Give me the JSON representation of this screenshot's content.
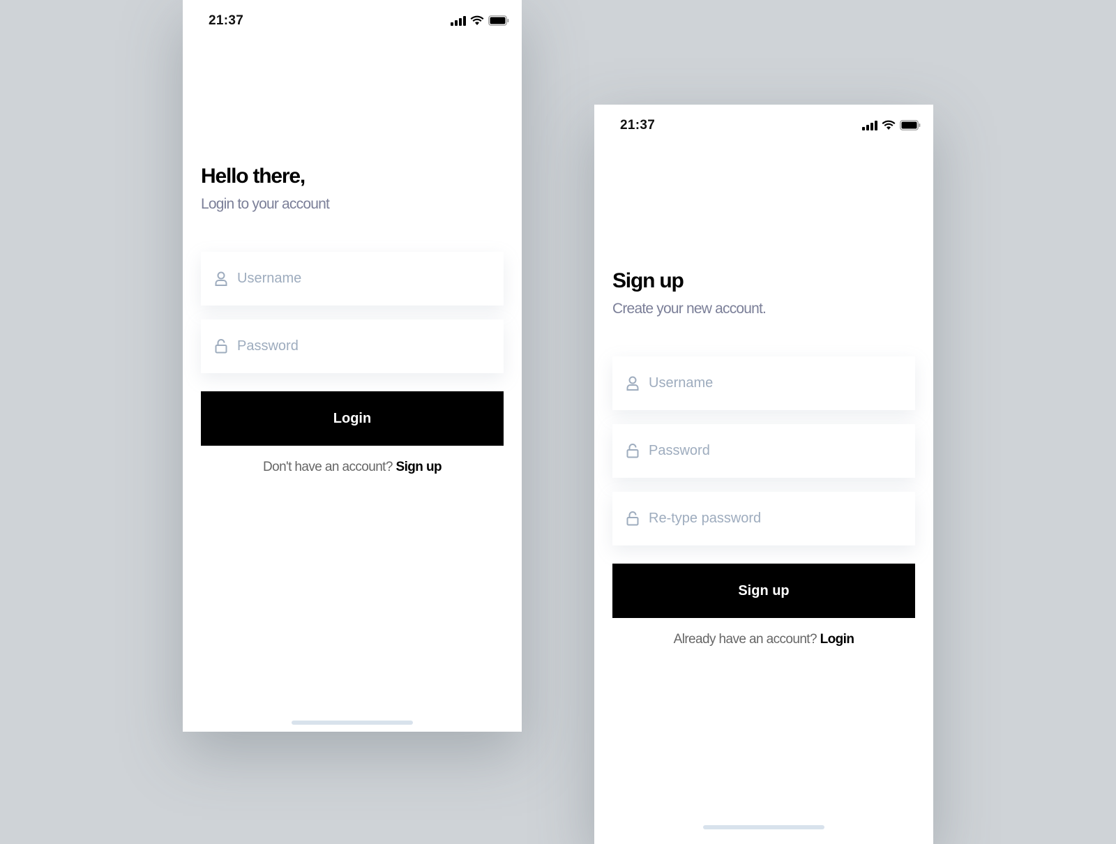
{
  "login_screen": {
    "status_time": "21:37",
    "title": "Hello there,",
    "subtitle": "Login to your account",
    "fields": [
      {
        "icon": "user-icon",
        "placeholder": "Username",
        "value": ""
      },
      {
        "icon": "lock-icon",
        "placeholder": "Password",
        "value": ""
      }
    ],
    "button_label": "Login",
    "footer_text": "Don't have an account?",
    "footer_link": "Sign up"
  },
  "signup_screen": {
    "status_time": "21:37",
    "title": "Sign up",
    "subtitle": "Create your new account.",
    "fields": [
      {
        "icon": "user-icon",
        "placeholder": "Username",
        "value": ""
      },
      {
        "icon": "lock-icon",
        "placeholder": "Password",
        "value": ""
      },
      {
        "icon": "lock-icon",
        "placeholder": "Re-type password",
        "value": ""
      }
    ],
    "button_label": "Sign up",
    "footer_text": "Already have an account?",
    "footer_link": "Login"
  },
  "colors": {
    "background": "#cfd3d7",
    "button": "#000000",
    "placeholder": "#9eacbe",
    "subtitle": "#7b7f98"
  }
}
